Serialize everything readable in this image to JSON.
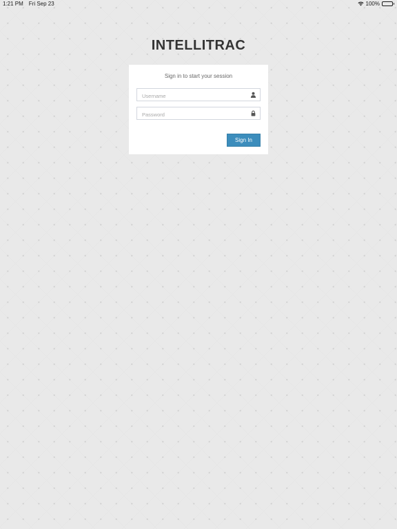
{
  "status_bar": {
    "time": "1:21 PM",
    "date": "Fri Sep 23",
    "battery_percent": "100%",
    "battery_level": 1.0
  },
  "brand": {
    "name": "INTELLITRAC"
  },
  "login": {
    "message": "Sign in to start your session",
    "username": {
      "placeholder": "Username",
      "value": "",
      "icon": "user-icon"
    },
    "password": {
      "placeholder": "Password",
      "value": "",
      "icon": "lock-icon"
    },
    "submit_label": "Sign In"
  },
  "colors": {
    "background": "#e9e9e9",
    "card": "#ffffff",
    "primary_button": "#3c8dbc",
    "brand_text": "#333333"
  }
}
